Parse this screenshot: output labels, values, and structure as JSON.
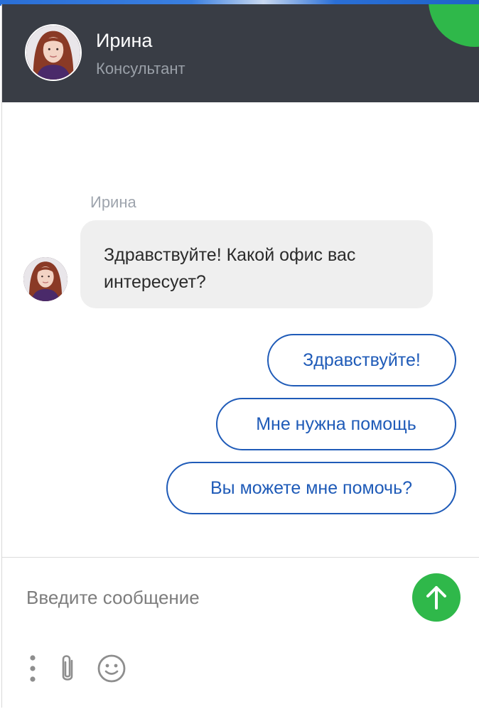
{
  "header": {
    "name": "Ирина",
    "role": "Консультант"
  },
  "conversation": {
    "sender_name": "Ирина",
    "message": "Здравствуйте! Какой офис вас интересует?"
  },
  "quick_replies": [
    "Здравствуйте!",
    "Мне нужна помощь",
    "Вы можете мне помочь?"
  ],
  "composer": {
    "placeholder": "Введите сообщение",
    "value": "",
    "icons": [
      "more-vertical-icon",
      "paperclip-icon",
      "smile-icon",
      "arrow-up-icon"
    ]
  },
  "colors": {
    "header_bg": "#393d45",
    "accent_green": "#2fb84a",
    "link_blue": "#1f5bb8",
    "bubble_bg": "#efefef"
  }
}
